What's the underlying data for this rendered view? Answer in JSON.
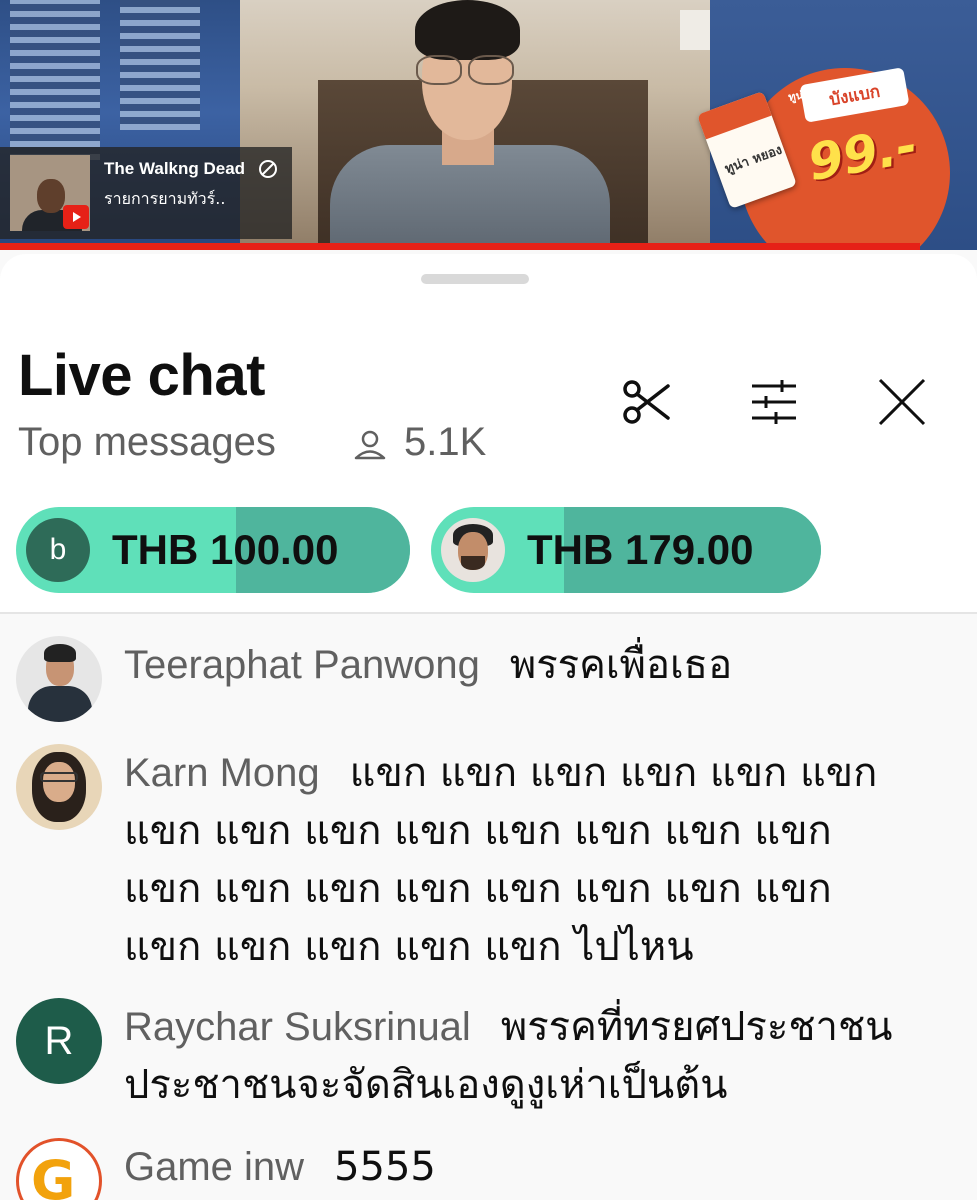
{
  "video": {
    "channel": {
      "name": "The Walkng Dead",
      "subtitle": "รายการยามทัวร์.."
    },
    "promo": {
      "top_text": "ทูน่าหยอง",
      "label": "บังแบก",
      "price": "99.-",
      "pack_text": "ทูน่า หยอง"
    }
  },
  "chat": {
    "title": "Live chat",
    "mode": "Top messages",
    "viewer_count": "5.1K",
    "toolbar": {
      "scissors": "scissors-icon",
      "filter": "tune-icon",
      "close": "close-icon"
    },
    "super_chats": [
      {
        "avatar_letter": "b",
        "amount": "THB 100.00",
        "progress": 0.44
      },
      {
        "avatar_letter": "",
        "amount": "THB 179.00",
        "progress": 0.66
      }
    ],
    "messages": [
      {
        "author": "Teeraphat Panwong",
        "text": "พรรคเพื่อเธอ"
      },
      {
        "author": "Karn Mong",
        "text": "แขก แขก แขก แขก แขก แขก แขก แขก แขก แขก แขก แขก แขก แขก แขก แขก แขก แขก แขก แขก แขก แขก แขก แขก แขก แขก แขก ไปไหน"
      },
      {
        "author": "Raychar Suksrinual",
        "avatar_letter": "R",
        "text": "พรรคที่ทรยศประชาชนประชาชนจะจัดสินเองดูงูเห่าเป็นต้น"
      },
      {
        "author": "Game inw",
        "text": "5555"
      }
    ]
  },
  "colors": {
    "super_chat_light": "#5fe0b9",
    "super_chat_dark": "#4fb59d",
    "progress_red": "#e62117",
    "author_gray": "#606060"
  }
}
